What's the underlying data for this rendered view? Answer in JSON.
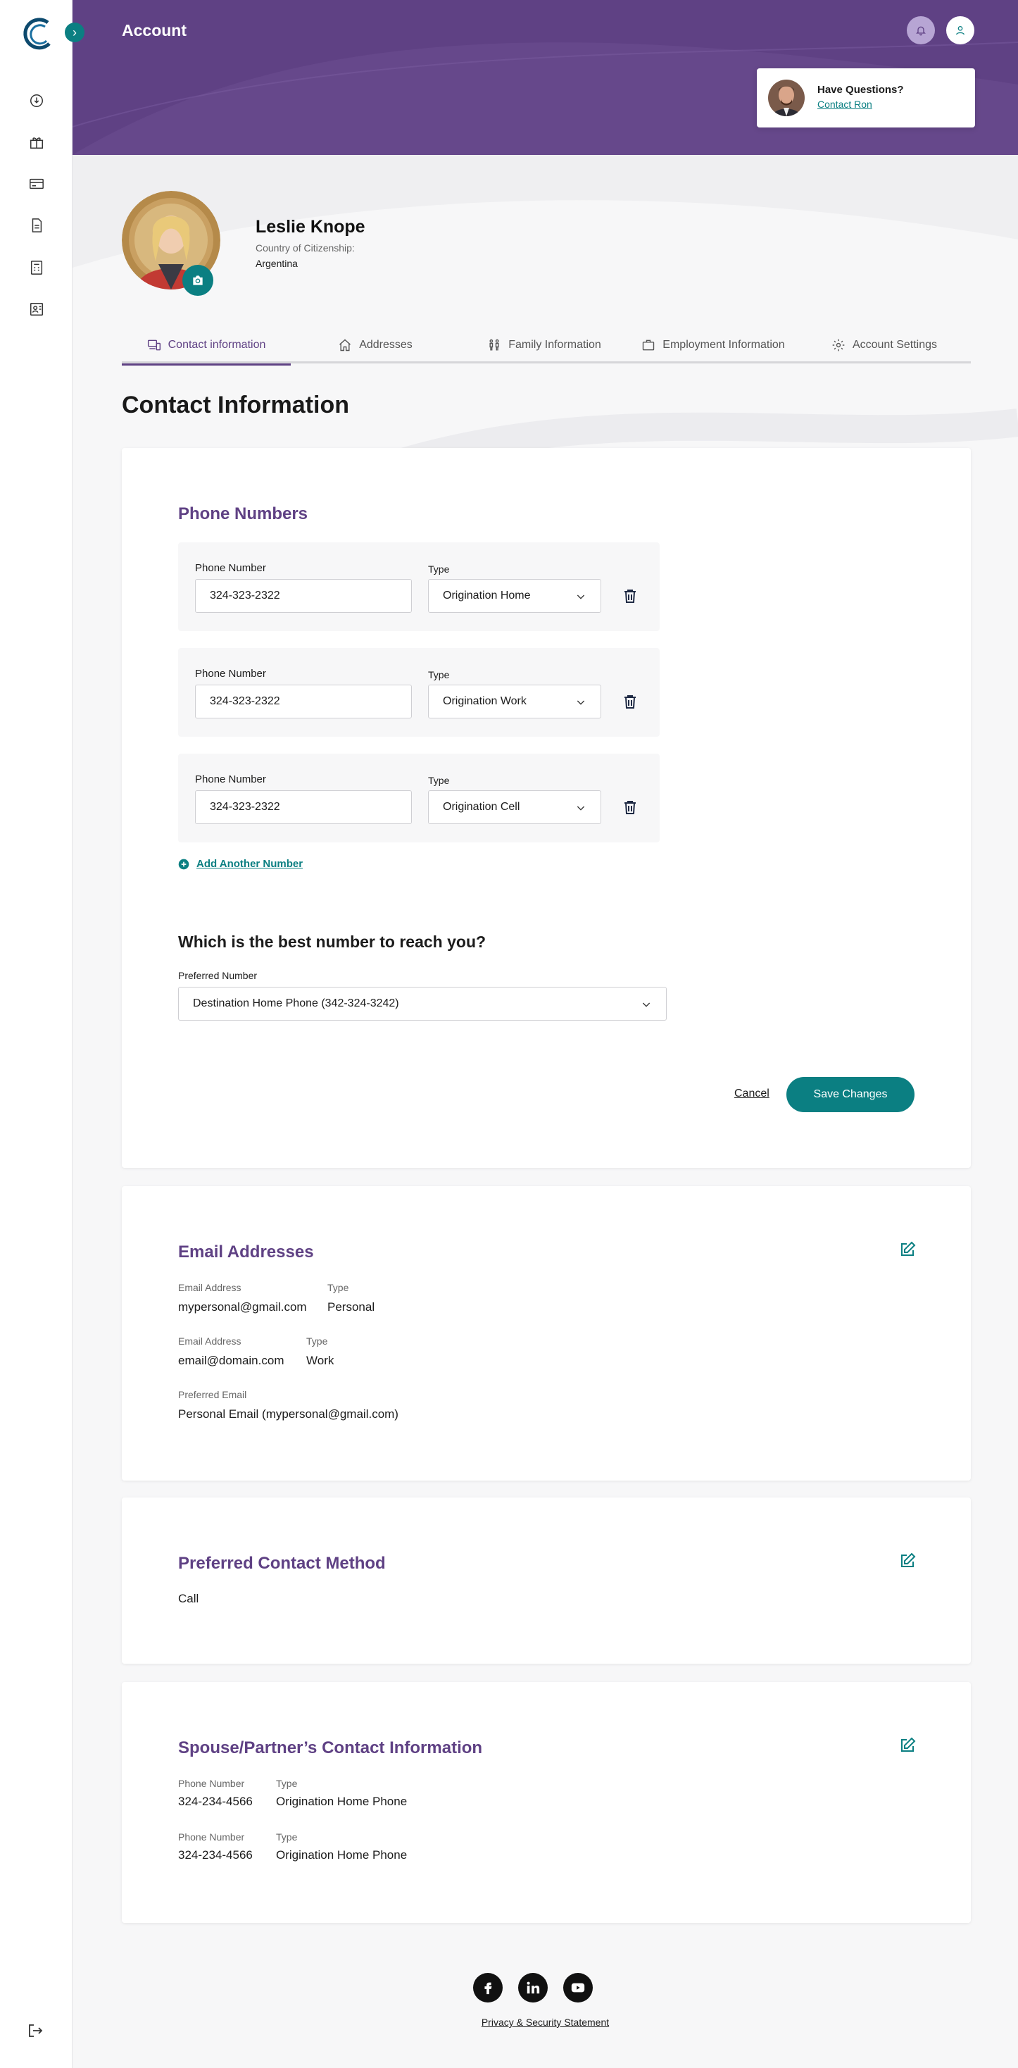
{
  "header": {
    "title": "Account",
    "help_title": "Have Questions?",
    "help_link": "Contact Ron"
  },
  "profile": {
    "name": "Leslie Knope",
    "citizenship_label": "Country of Citizenship:",
    "citizenship_value": "Argentina"
  },
  "tabs": [
    {
      "label": "Contact information",
      "icon": "devices-icon",
      "active": true
    },
    {
      "label": "Addresses",
      "icon": "home-icon"
    },
    {
      "label": "Family Information",
      "icon": "family-icon"
    },
    {
      "label": "Employment Information",
      "icon": "briefcase-icon"
    },
    {
      "label": "Account Settings",
      "icon": "gear-icon"
    }
  ],
  "page_title": "Contact Information",
  "phone_section": {
    "title": "Phone Numbers",
    "phone_label": "Phone Number",
    "type_label": "Type",
    "rows": [
      {
        "number": "324-323-2322",
        "type": "Origination Home"
      },
      {
        "number": "324-323-2322",
        "type": "Origination Work"
      },
      {
        "number": "324-323-2322",
        "type": "Origination Cell"
      }
    ],
    "add_label": "Add Another Number",
    "question": "Which is the best number to reach you?",
    "preferred_label": "Preferred Number",
    "preferred_value": "Destination Home Phone (342-324-3242)",
    "cancel_label": "Cancel",
    "save_label": "Save Changes"
  },
  "email_section": {
    "title": "Email Addresses",
    "email_label": "Email Address",
    "type_label": "Type",
    "emails": [
      {
        "address": "mypersonal@gmail.com",
        "type": "Personal"
      },
      {
        "address": "email@domain.com",
        "type": "Work"
      }
    ],
    "preferred_label": "Preferred Email",
    "preferred_value": "Personal Email (mypersonal@gmail.com)"
  },
  "contact_method": {
    "title": "Preferred Contact Method",
    "value": "Call"
  },
  "spouse_section": {
    "title": "Spouse/Partner’s Contact Information",
    "phone_label": "Phone Number",
    "type_label": "Type",
    "rows": [
      {
        "number": "324-234-4566",
        "type": "Origination Home Phone"
      },
      {
        "number": "324-234-4566",
        "type": "Origination Home Phone"
      }
    ]
  },
  "footer": {
    "privacy_link": "Privacy & Security Statement",
    "social": [
      "facebook-icon",
      "linkedin-icon",
      "youtube-icon"
    ]
  },
  "colors": {
    "brand_purple": "#5f4184",
    "accent_teal": "#0b7f82"
  }
}
